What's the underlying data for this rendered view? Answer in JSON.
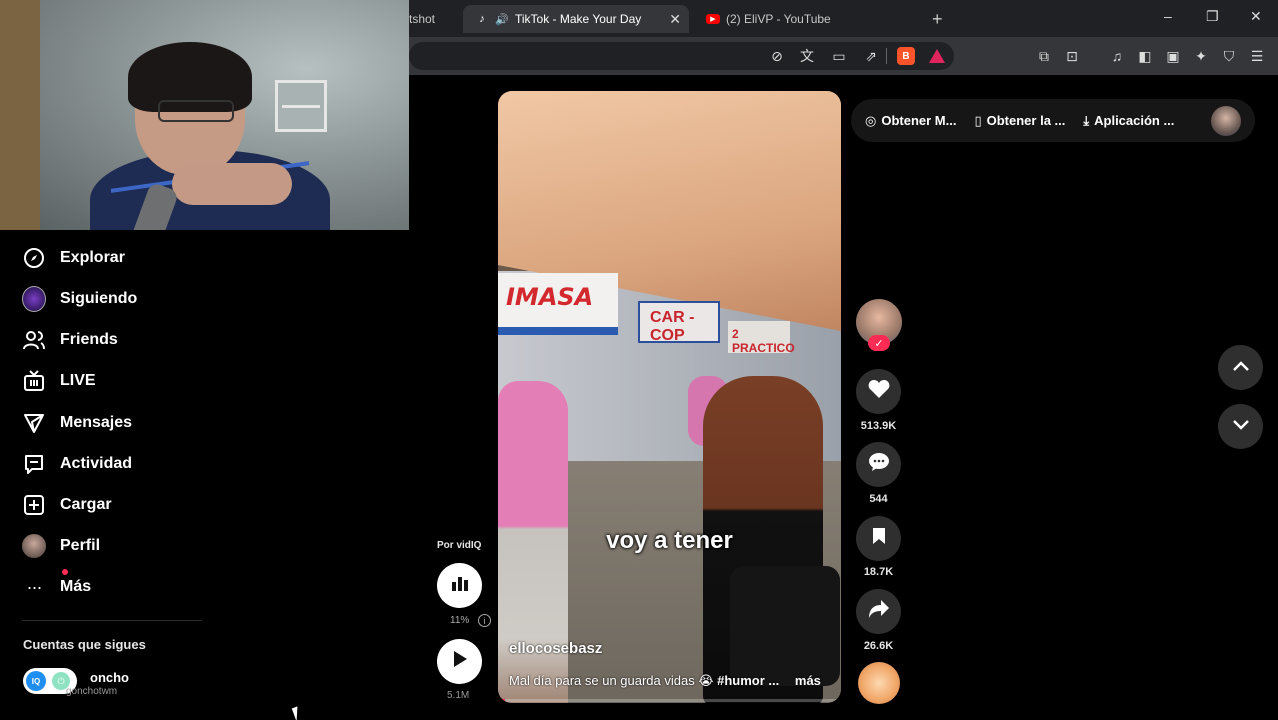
{
  "browser": {
    "tabs": [
      {
        "label": "tshot",
        "active": false
      },
      {
        "label": "TikTok - Make Your Day",
        "active": true,
        "audio": true
      },
      {
        "label": "(2) EliVP - YouTube",
        "active": false
      }
    ],
    "new_tab_label": "+",
    "window_controls": {
      "minimize": "–",
      "restore": "❐",
      "close": "✕"
    }
  },
  "sidebar": {
    "items": [
      {
        "label": "Explorar",
        "icon": "compass-icon"
      },
      {
        "label": "Siguiendo",
        "icon": "following-avatar-icon"
      },
      {
        "label": "Friends",
        "icon": "friends-icon"
      },
      {
        "label": "LIVE",
        "icon": "live-tv-icon"
      },
      {
        "label": "Mensajes",
        "icon": "send-icon"
      },
      {
        "label": "Actividad",
        "icon": "activity-icon"
      },
      {
        "label": "Cargar",
        "icon": "upload-plus-icon"
      },
      {
        "label": "Perfil",
        "icon": "profile-avatar-icon"
      },
      {
        "label": "Más",
        "icon": "more-dots-icon"
      }
    ],
    "following_title": "Cuentas que sigues",
    "following_accounts": [
      {
        "name": "oncho",
        "handle": "gonchotwm"
      }
    ]
  },
  "getapp": {
    "items": [
      {
        "label": "Obtener M...",
        "icon": "coin-icon"
      },
      {
        "label": "Obtener la ...",
        "icon": "phone-icon"
      },
      {
        "label": "Aplicación ...",
        "icon": "download-icon"
      }
    ]
  },
  "video": {
    "caption": "voy a tener",
    "author": "ellocosebasz",
    "description": "Mal día para se un  guarda vidas 😭 ",
    "hashtag": "#humor ...",
    "more": "más",
    "signs": [
      "IMASA",
      "CAR - COP",
      "2 PRACTICO"
    ],
    "progress": 0.02
  },
  "actions": {
    "likes": "513.9K",
    "comments": "544",
    "saves": "18.7K",
    "shares": "26.6K"
  },
  "vidiq": {
    "label": "Por vidIQ",
    "percent": "11%",
    "info": "i",
    "views": "5.1M"
  },
  "colors": {
    "accent": "#fe2c55",
    "background": "#000000",
    "chrome_dark": "#202124",
    "chrome_toolbar": "#35363a"
  }
}
